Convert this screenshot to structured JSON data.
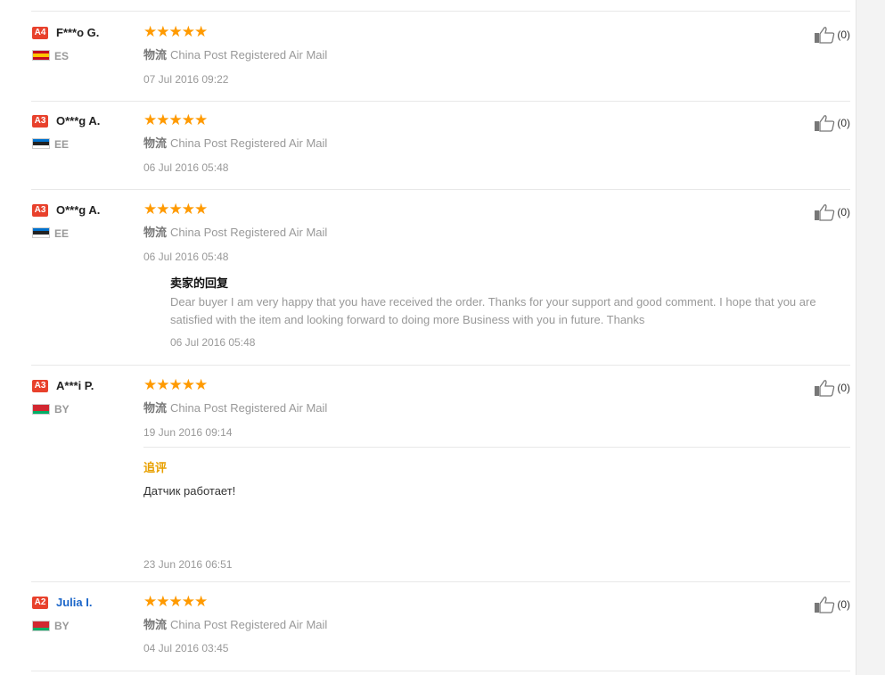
{
  "reviews": [
    {
      "level": "A4",
      "name": "F***o G.",
      "name_link": false,
      "country": "ES",
      "flag_colors": [
        "#c60b1e",
        "#ffc400",
        "#c60b1e"
      ],
      "stars": "★★★★★",
      "logistics_label": "物流",
      "logistics": "China Post Registered Air Mail",
      "date": "07 Jul 2016 09:22",
      "likes": "(0)"
    },
    {
      "level": "A3",
      "name": "O***g A.",
      "name_link": false,
      "country": "EE",
      "flag_colors": [
        "#0072ce",
        "#222222",
        "#ffffff"
      ],
      "stars": "★★★★★",
      "logistics_label": "物流",
      "logistics": "China Post Registered Air Mail",
      "date": "06 Jul 2016 05:48",
      "likes": "(0)"
    },
    {
      "level": "A3",
      "name": "O***g A.",
      "name_link": false,
      "country": "EE",
      "flag_colors": [
        "#0072ce",
        "#222222",
        "#ffffff"
      ],
      "stars": "★★★★★",
      "logistics_label": "物流",
      "logistics": "China Post Registered Air Mail",
      "date": "06 Jul 2016 05:48",
      "likes": "(0)",
      "seller_reply": {
        "title": "卖家的回复",
        "text": "Dear buyer I am very happy that you have received the order. Thanks for your support and good comment. I hope that you are satisfied with the item and looking forward to doing more Business with you in future. Thanks",
        "date": "06 Jul 2016 05:48"
      }
    },
    {
      "level": "A3",
      "name": "A***i P.",
      "name_link": false,
      "country": "BY",
      "flag_colors": [
        "#d22730",
        "#d22730",
        "#00af66"
      ],
      "stars": "★★★★★",
      "logistics_label": "物流",
      "logistics": "China Post Registered Air Mail",
      "date": "19 Jun 2016 09:14",
      "likes": "(0)",
      "followup": {
        "title": "追评",
        "text": "Датчик работает!",
        "date": "23 Jun 2016 06:51"
      }
    },
    {
      "level": "A2",
      "name": "Julia I.",
      "name_link": true,
      "country": "BY",
      "flag_colors": [
        "#d22730",
        "#d22730",
        "#00af66"
      ],
      "stars": "★★★★★",
      "logistics_label": "物流",
      "logistics": "China Post Registered Air Mail",
      "date": "04 Jul 2016 03:45",
      "likes": "(0)"
    }
  ]
}
